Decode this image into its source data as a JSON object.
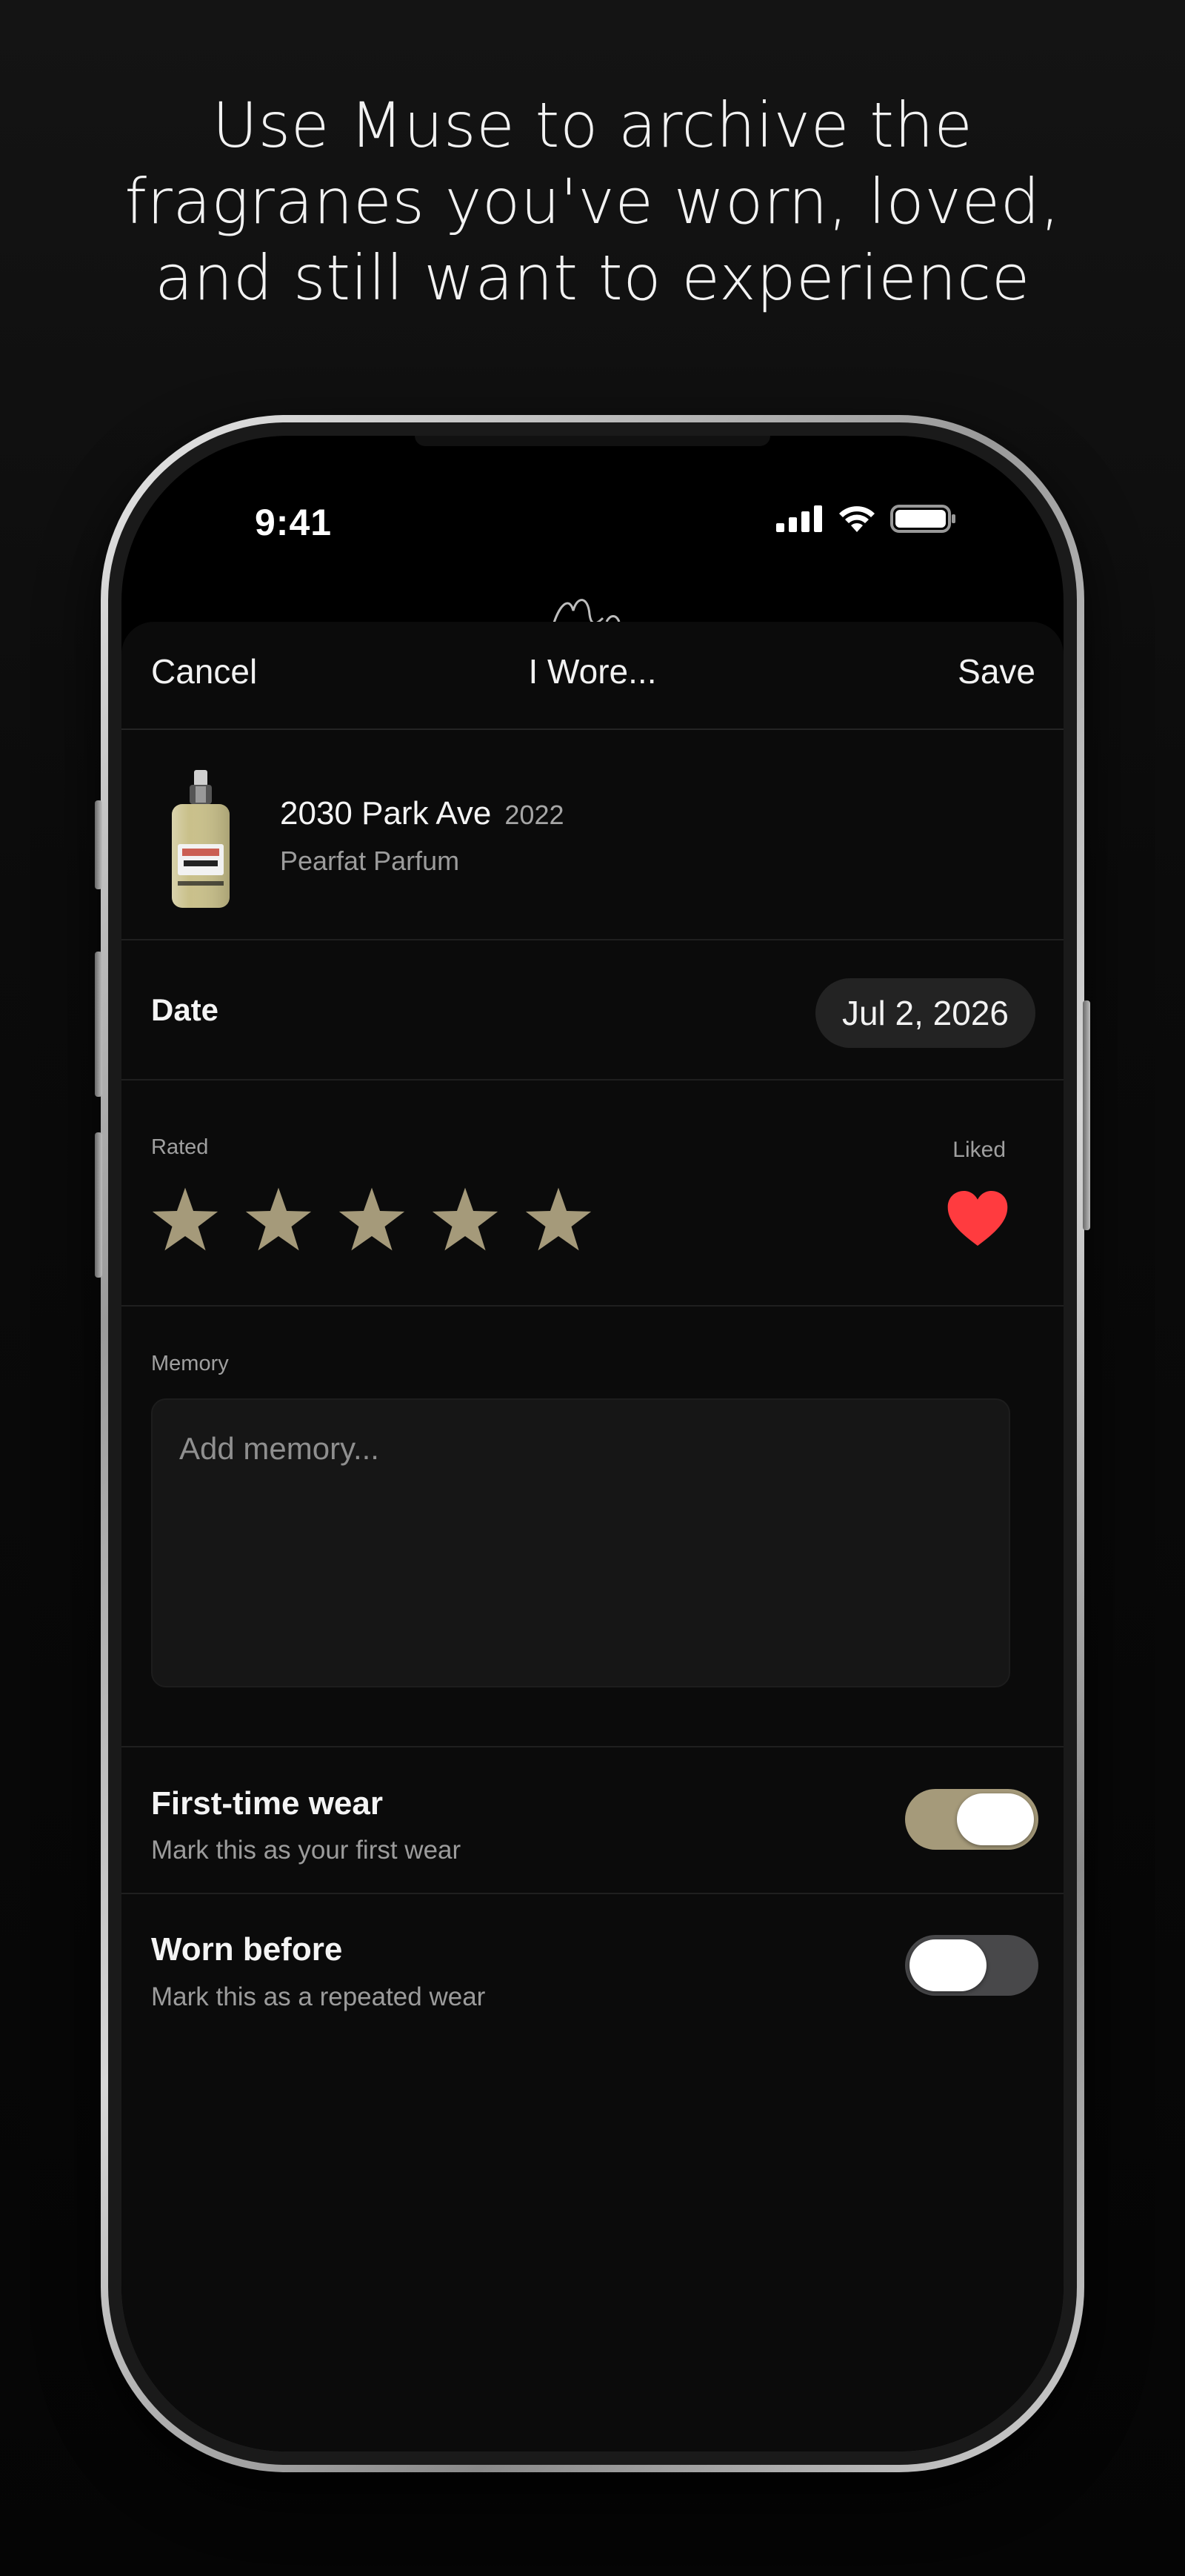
{
  "marketing": {
    "headline_lines": [
      "Use Muse to archive the",
      "fragranes you've worn, loved,",
      "and still want to experience"
    ]
  },
  "status_bar": {
    "time": "9:41",
    "icons": [
      "cellular-signal-icon",
      "wifi-icon",
      "battery-icon"
    ]
  },
  "sheet": {
    "nav": {
      "cancel_label": "Cancel",
      "title": "I Wore...",
      "save_label": "Save"
    },
    "fragrance": {
      "name": "2030 Park Ave",
      "year": "2022",
      "brand": "Pearfat Parfum"
    },
    "date": {
      "label": "Date",
      "value": "Jul 2, 2026"
    },
    "rating": {
      "label": "Rated",
      "stars": 5,
      "max_stars": 5,
      "liked_label": "Liked",
      "liked": true
    },
    "memory": {
      "label": "Memory",
      "placeholder": "Add memory..."
    },
    "toggles": [
      {
        "title": "First-time wear",
        "subtitle": "Mark this as your first wear",
        "on": true
      },
      {
        "title": "Worn before",
        "subtitle": "Mark this as a repeated wear",
        "on": false
      }
    ]
  },
  "colors": {
    "background": "#0b0b0b",
    "accent_gold": "#a59a7a",
    "heart_red": "#ff3b3f",
    "toggle_off": "#48484a",
    "date_pill": "#232323"
  }
}
